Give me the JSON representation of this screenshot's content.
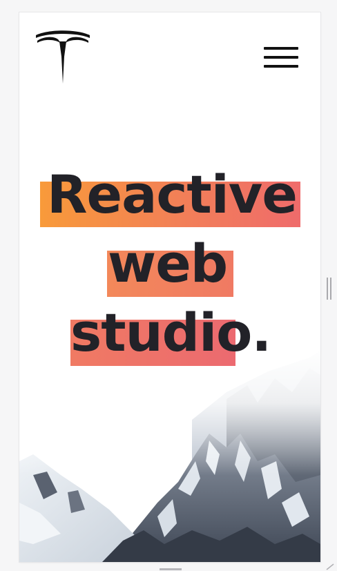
{
  "header": {
    "logo_icon": "tesla-logo-icon",
    "menu_icon": "hamburger-menu-icon"
  },
  "hero": {
    "line1": "Reactive",
    "line2": "web",
    "line3": "studio.",
    "highlight_colors": [
      "#f89a3a",
      "#f27f58",
      "#ef6b6b"
    ],
    "text_color": "#222228"
  },
  "background": {
    "image": "snowy-mountain-peak"
  }
}
